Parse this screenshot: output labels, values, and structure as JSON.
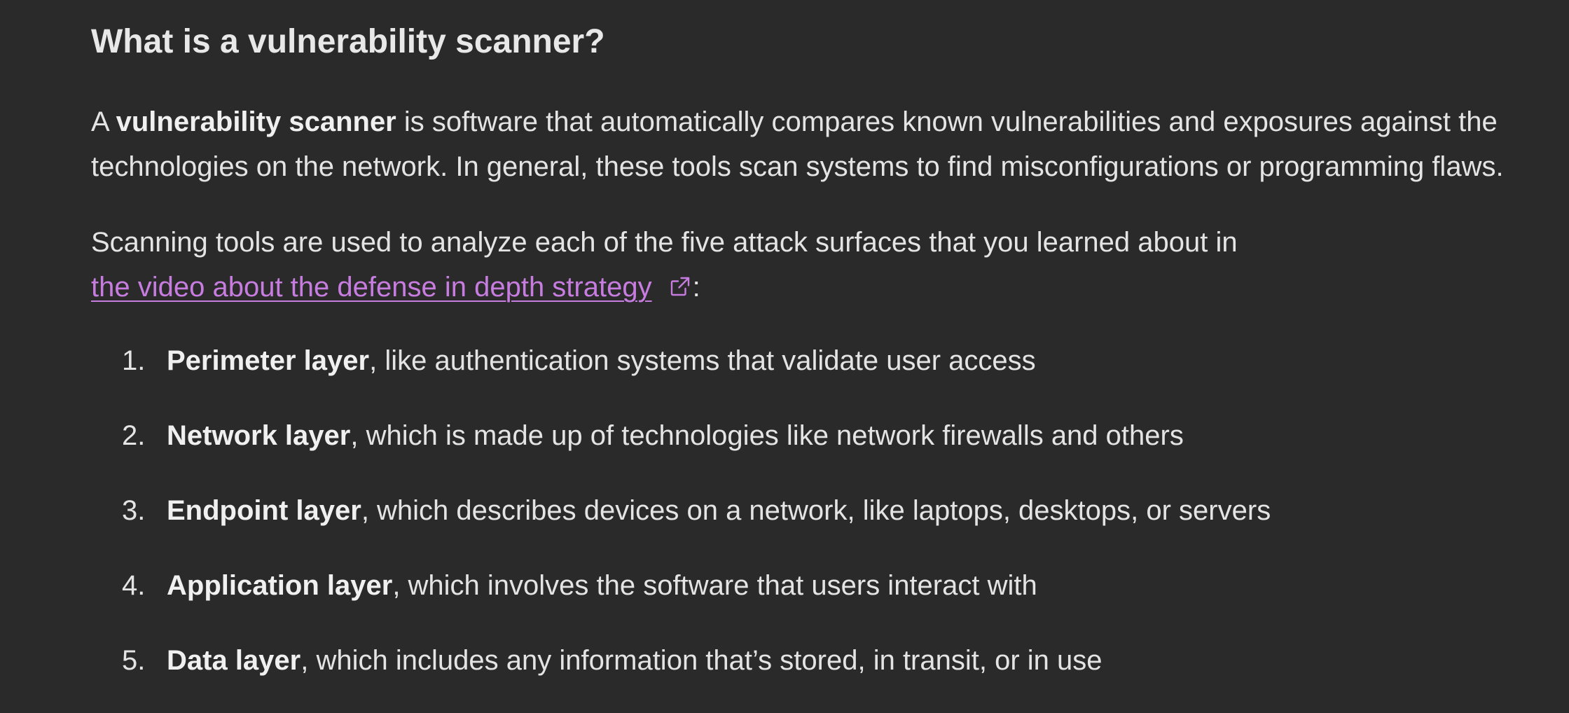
{
  "article": {
    "heading": "What is a vulnerability scanner?",
    "paragraph1": {
      "intro": "A ",
      "bold_term": "vulnerability scanner",
      "rest_line1": " is software that automatically compares known vulnerabilities and exposures against the",
      "line2": "technologies on the network. In general, these tools scan systems to find misconfigurations or programming flaws."
    },
    "paragraph2": {
      "line1": "Scanning tools are used to analyze each of the five attack surfaces that you learned about in",
      "link_text": "the video about the defense in depth strategy",
      "after_link": ":"
    },
    "layers": [
      {
        "number": "1.",
        "name": "Perimeter layer",
        "description": ", like authentication systems that validate user access"
      },
      {
        "number": "2.",
        "name": "Network layer",
        "description": ", which is made up of technologies like network firewalls and others"
      },
      {
        "number": "3.",
        "name": "Endpoint layer",
        "description": ", which describes devices on a network, like laptops, desktops, or servers"
      },
      {
        "number": "4.",
        "name": "Application layer",
        "description": ", which involves the software that users interact with"
      },
      {
        "number": "5.",
        "name": "Data layer",
        "description": ", which includes any information that’s stored, in transit, or in use"
      }
    ]
  },
  "colors": {
    "background": "#2a2a2a",
    "text": "#e4e4e4",
    "link": "#c77ddf"
  },
  "icons": {
    "external_link": "external-link-icon"
  }
}
